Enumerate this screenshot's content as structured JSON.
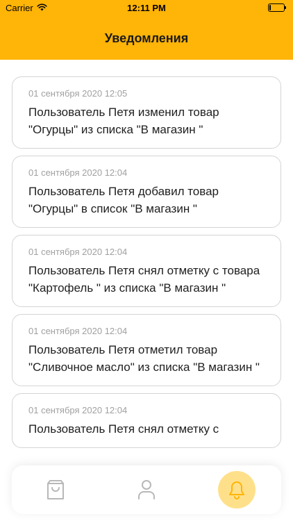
{
  "status_bar": {
    "carrier": "Carrier",
    "time": "12:11 PM",
    "battery_level": 0.1
  },
  "header": {
    "title": "Уведомления"
  },
  "notifications": [
    {
      "date": "01 сентября 2020 12:05",
      "text": "Пользователь Петя изменил товар \"Огурцы\" из списка \"В магазин \""
    },
    {
      "date": "01 сентября 2020 12:04",
      "text": "Пользователь Петя добавил товар \"Огурцы\" в список \"В магазин \""
    },
    {
      "date": "01 сентября 2020 12:04",
      "text": "Пользователь Петя снял отметку с товара \"Картофель \" из списка \"В магазин \""
    },
    {
      "date": "01 сентября 2020 12:04",
      "text": "Пользователь Петя отметил товар \"Сливочное масло\" из списка \"В магазин \""
    },
    {
      "date": "01 сентября 2020 12:04",
      "text": "Пользователь Петя снял отметку с"
    }
  ],
  "tabbar": {
    "tabs": [
      {
        "icon": "shopping-bag-icon",
        "active": false
      },
      {
        "icon": "user-icon",
        "active": false
      },
      {
        "icon": "bell-icon",
        "active": true
      }
    ]
  },
  "colors": {
    "accent": "#FFB408",
    "active_tab_bg": "#FFE08A",
    "date_text": "#a0a0a0",
    "icon_gray": "#b8b8b8"
  }
}
